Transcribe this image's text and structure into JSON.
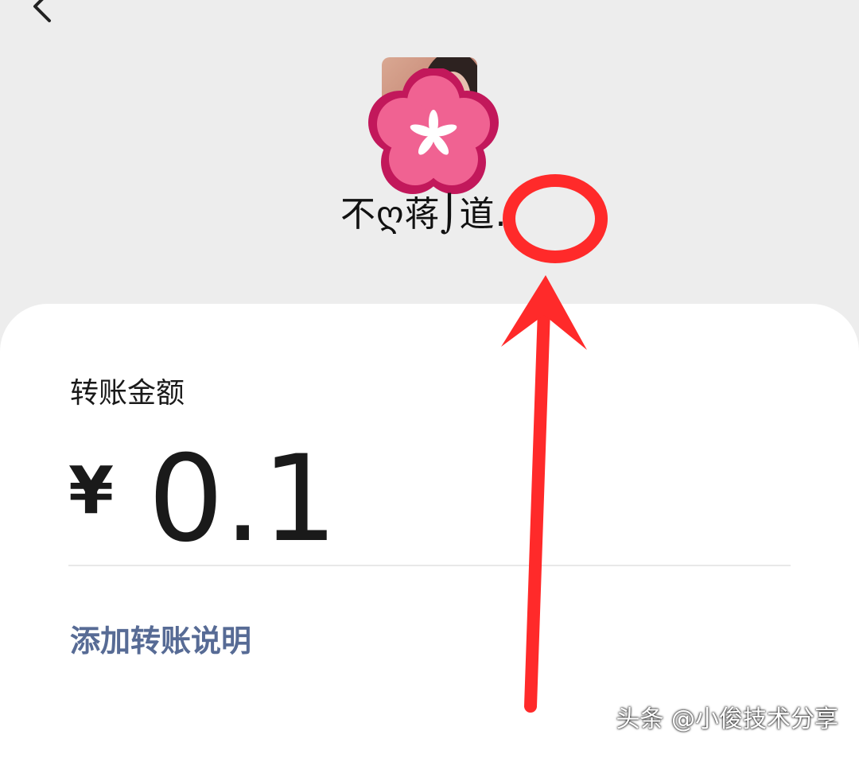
{
  "header": {
    "back_icon": "chevron-left-icon"
  },
  "payee": {
    "name": "不ღ蒋⌡道.."
  },
  "transfer": {
    "amount_label": "转账金额",
    "currency_symbol": "¥",
    "amount": "0.1",
    "add_note_label": "添加转账说明"
  },
  "watermark": {
    "text": "头条 @小俊技术分享"
  },
  "colors": {
    "link": "#576b95",
    "annotation_red": "#ff2a2a",
    "background": "#ededed",
    "card": "#ffffff"
  }
}
